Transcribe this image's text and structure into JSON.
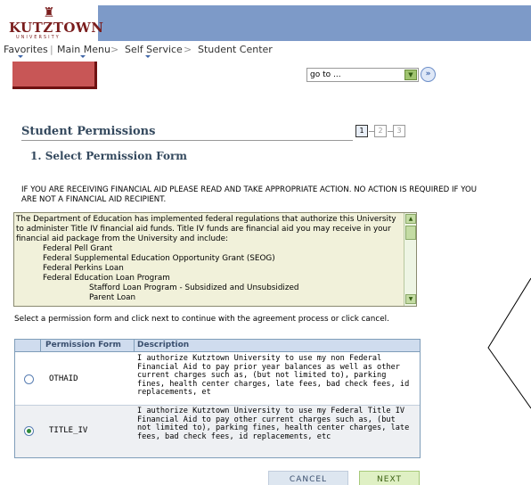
{
  "logo": {
    "name": "KUTZTOWN",
    "subtitle": "UNIVERSITY"
  },
  "nav": {
    "favorites": "Favorites",
    "main_menu": "Main Menu",
    "sep": ">",
    "self_service": "Self Service",
    "student_center": "Student Center"
  },
  "goto": {
    "value": "go to ..."
  },
  "page": {
    "title": "Student Permissions",
    "subtitle": "1. Select Permission Form",
    "steps": [
      "1",
      "2",
      "3"
    ],
    "notice": "IF YOU ARE RECEIVING FINANCIAL AID PLEASE READ AND TAKE APPROPRIATE ACTION. NO ACTION IS REQUIRED IF YOU ARE NOT A FINANCIAL AID RECIPIENT.",
    "instruction": "Select a permission form and click next to continue with the agreement process or click cancel."
  },
  "info": {
    "intro": "The Department of Education has implemented federal regulations that authorize this University to administer Title IV financial aid funds. Title IV funds are financial aid you may receive in your financial aid package from the University and include:",
    "items": [
      "Federal Pell Grant",
      "Federal Supplemental Education Opportunity Grant (SEOG)",
      "Federal Perkins Loan",
      "Federal Education Loan Program"
    ],
    "subitems": [
      "Stafford Loan Program - Subsidized and Unsubsidized",
      "Parent Loan"
    ]
  },
  "grid": {
    "headers": [
      "Permission Form",
      "Description"
    ],
    "rows": [
      {
        "code": "OTHAID",
        "selected": false,
        "description": "I authorize Kutztown University to use my non Federal Financial Aid to pay prior year balances as well as other current charges such as, (but not limited to), parking fines, health center charges, late fees, bad check fees, id replacements, et"
      },
      {
        "code": "TITLE_IV",
        "selected": true,
        "description": "I authorize Kutztown University to use my Federal Title IV Financial Aid to pay other current charges such as, (but not limited to), parking fines, health center charges, late fees, bad check fees, id replacements, etc"
      }
    ]
  },
  "buttons": {
    "cancel": "CANCEL",
    "next": "NEXT"
  },
  "colors": {
    "banner": "#7d9ac8",
    "accent_red": "#c85656",
    "grid_header": "#cfdcee",
    "next_green": "#dff0c4"
  }
}
